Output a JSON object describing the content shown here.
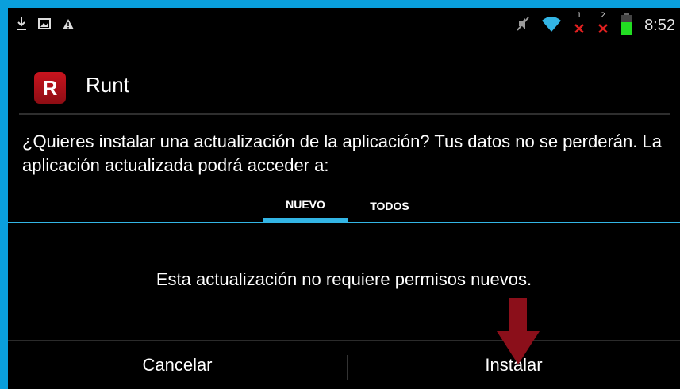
{
  "status_bar": {
    "left_icons": [
      "download-icon",
      "image-icon",
      "warning-icon"
    ],
    "right_icons": [
      "mute-icon",
      "wifi-icon",
      "signal1-no-service-icon",
      "signal2-no-service-icon",
      "battery-icon"
    ],
    "sim1_label": "1",
    "sim2_label": "2",
    "time": "8:52",
    "battery_color": "#22dd22"
  },
  "app": {
    "icon_letter": "R",
    "name": "Runt",
    "icon_color": "#b3111a"
  },
  "dialog": {
    "question": "¿Quieres instalar una actualización de la aplicación? Tus datos no se perderán. La aplicación actualizada podrá acceder a:",
    "tabs": [
      {
        "label": "NUEVO",
        "active": true
      },
      {
        "label": "TODOS",
        "active": false
      }
    ],
    "message": "Esta actualización no requiere permisos nuevos.",
    "buttons": {
      "cancel": "Cancelar",
      "install": "Instalar"
    }
  },
  "annotation": {
    "arrow_icon": "down-arrow-icon",
    "arrow_color": "#8b0f1a"
  },
  "colors": {
    "accent": "#33b5e5",
    "frame": "#0a9fdc"
  }
}
